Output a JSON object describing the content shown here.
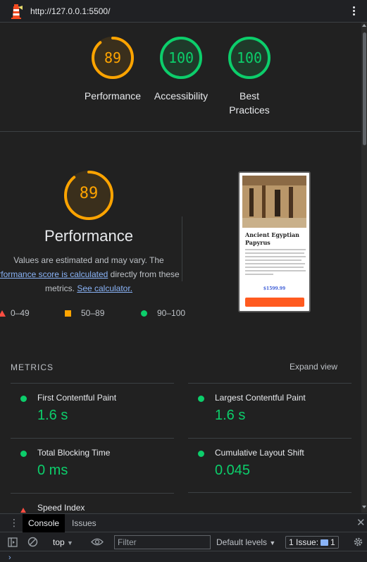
{
  "browser": {
    "url": "http://127.0.0.1:5500/"
  },
  "summary_gauges": [
    {
      "label": "Performance",
      "score": "89",
      "color": "#ffa400",
      "fraction": 0.89
    },
    {
      "label": "Accessibility",
      "score": "100",
      "color": "#0cce6b",
      "fraction": 1.0
    },
    {
      "label": "Best Practices",
      "label_line1": "Best",
      "label_line2": "Practices",
      "score": "100",
      "color": "#0cce6b",
      "fraction": 1.0
    }
  ],
  "performance": {
    "score": "89",
    "score_fraction": 0.89,
    "title": "Performance",
    "desc_line1": "Values are estimated and may vary. The",
    "desc_link1": "rformance score is calculated",
    "desc_after_link1": " directly from these",
    "desc_line3_prefix": "metrics.",
    "desc_link2": "See calculator."
  },
  "legend": [
    {
      "range": "0–49",
      "shape": "triangle",
      "color": "#ff4e42"
    },
    {
      "range": "50–89",
      "shape": "square",
      "color": "#ffa400"
    },
    {
      "range": "90–100",
      "shape": "circle",
      "color": "#0cce6b"
    }
  ],
  "thumbnail": {
    "title": "Ancient Egyptian Papyrus",
    "price": "$1599.99"
  },
  "metrics": {
    "heading": "METRICS",
    "expand": "Expand view",
    "items": [
      {
        "title": "First Contentful Paint",
        "value": "1.6 s",
        "status": "pass"
      },
      {
        "title": "Largest Contentful Paint",
        "value": "1.6 s",
        "status": "pass"
      },
      {
        "title": "Total Blocking Time",
        "value": "0 ms",
        "status": "pass"
      },
      {
        "title": "Cumulative Layout Shift",
        "value": "0.045",
        "status": "pass"
      },
      {
        "title": "Speed Index",
        "value": "",
        "status": "fail"
      }
    ]
  },
  "devtools": {
    "tabs": [
      "Console",
      "Issues"
    ],
    "context": "top",
    "filter_placeholder": "Filter",
    "levels": "Default levels",
    "issues_label": "1 Issue:",
    "issues_count": "1"
  }
}
